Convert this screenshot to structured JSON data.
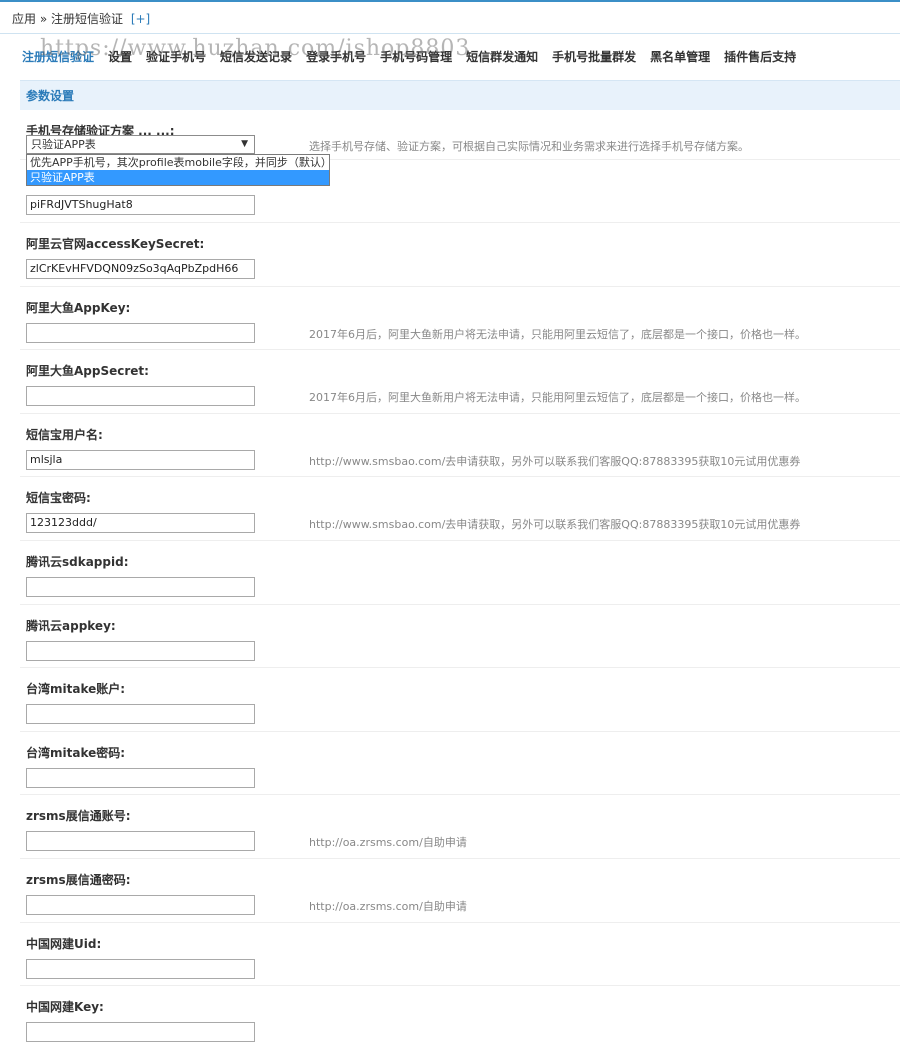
{
  "breadcrumb": {
    "text": "应用 » 注册短信验证",
    "add": "[+]"
  },
  "nav": {
    "tabs": [
      "注册短信验证",
      "设置",
      "验证手机号",
      "短信发送记录",
      "登录手机号",
      "手机号码管理",
      "短信群发通知",
      "手机号批量群发",
      "黑名单管理",
      "插件售后支持"
    ],
    "watermark": "https://www.huzhan.com/ishop8803"
  },
  "section": {
    "title": "参数设置"
  },
  "scheme": {
    "label": "手机号存储验证方案 ... ...:",
    "selected": "只验证APP表",
    "options": [
      "优先APP手机号，其次profile表mobile字段，并同步（默认）",
      "只验证APP表"
    ],
    "hint": "选择手机号存储、验证方案，可根据自己实际情况和业务需求来进行选择手机号存储方案。"
  },
  "fields": [
    {
      "label": "",
      "value": "piFRdJVTShugHat8",
      "hint": ""
    },
    {
      "label": "阿里云官网accessKeySecret:",
      "value": "zlCrKEvHFVDQN09zSo3qAqPbZpdH66",
      "hint": ""
    },
    {
      "label": "阿里大鱼AppKey:",
      "value": "",
      "hint": "2017年6月后，阿里大鱼新用户将无法申请，只能用阿里云短信了，底层都是一个接口，价格也一样。"
    },
    {
      "label": "阿里大鱼AppSecret:",
      "value": "",
      "hint": "2017年6月后，阿里大鱼新用户将无法申请，只能用阿里云短信了，底层都是一个接口，价格也一样。"
    },
    {
      "label": "短信宝用户名:",
      "value": "mlsjla",
      "hint": "http://www.smsbao.com/去申请获取，另外可以联系我们客服QQ:87883395获取10元试用优惠券"
    },
    {
      "label": "短信宝密码:",
      "value": "123123ddd/",
      "hint": "http://www.smsbao.com/去申请获取，另外可以联系我们客服QQ:87883395获取10元试用优惠券"
    },
    {
      "label": "腾讯云sdkappid:",
      "value": "",
      "hint": ""
    },
    {
      "label": "腾讯云appkey:",
      "value": "",
      "hint": ""
    },
    {
      "label": "台湾mitake账户:",
      "value": "",
      "hint": ""
    },
    {
      "label": "台湾mitake密码:",
      "value": "",
      "hint": ""
    },
    {
      "label": "zrsms展信通账号:",
      "value": "",
      "hint": "http://oa.zrsms.com/自助申请"
    },
    {
      "label": "zrsms展信通密码:",
      "value": "",
      "hint": "http://oa.zrsms.com/自助申请"
    },
    {
      "label": "中国网建Uid:",
      "value": "",
      "hint": ""
    },
    {
      "label": "中国网建Key:",
      "value": "",
      "hint": ""
    }
  ]
}
